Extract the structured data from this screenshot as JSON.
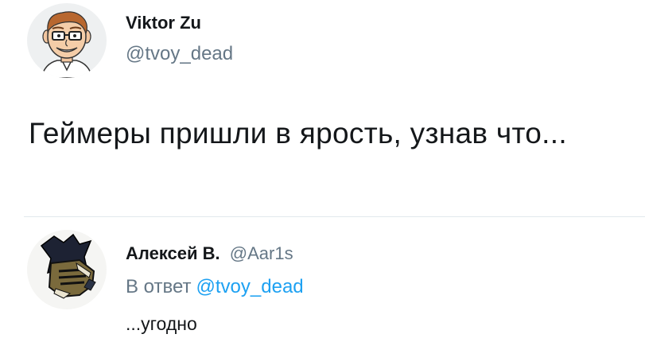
{
  "main_tweet": {
    "author_name": "Viktor Zu",
    "author_handle": "@tvoy_dead",
    "text": "Геймеры пришли в ярость, узнав что...",
    "avatar_icon": "cartoon-man-glasses-avatar"
  },
  "reply": {
    "author_name": "Алексей В.",
    "author_handle": "@Aar1s",
    "reply_to_prefix": "В ответ",
    "reply_to_handle": "@tvoy_dead",
    "text": "...угодно",
    "avatar_icon": "dark-knight-helmet-avatar"
  },
  "colors": {
    "text": "#14171a",
    "muted": "#657786",
    "link": "#1da1f2",
    "divider": "#e1e8ed"
  }
}
